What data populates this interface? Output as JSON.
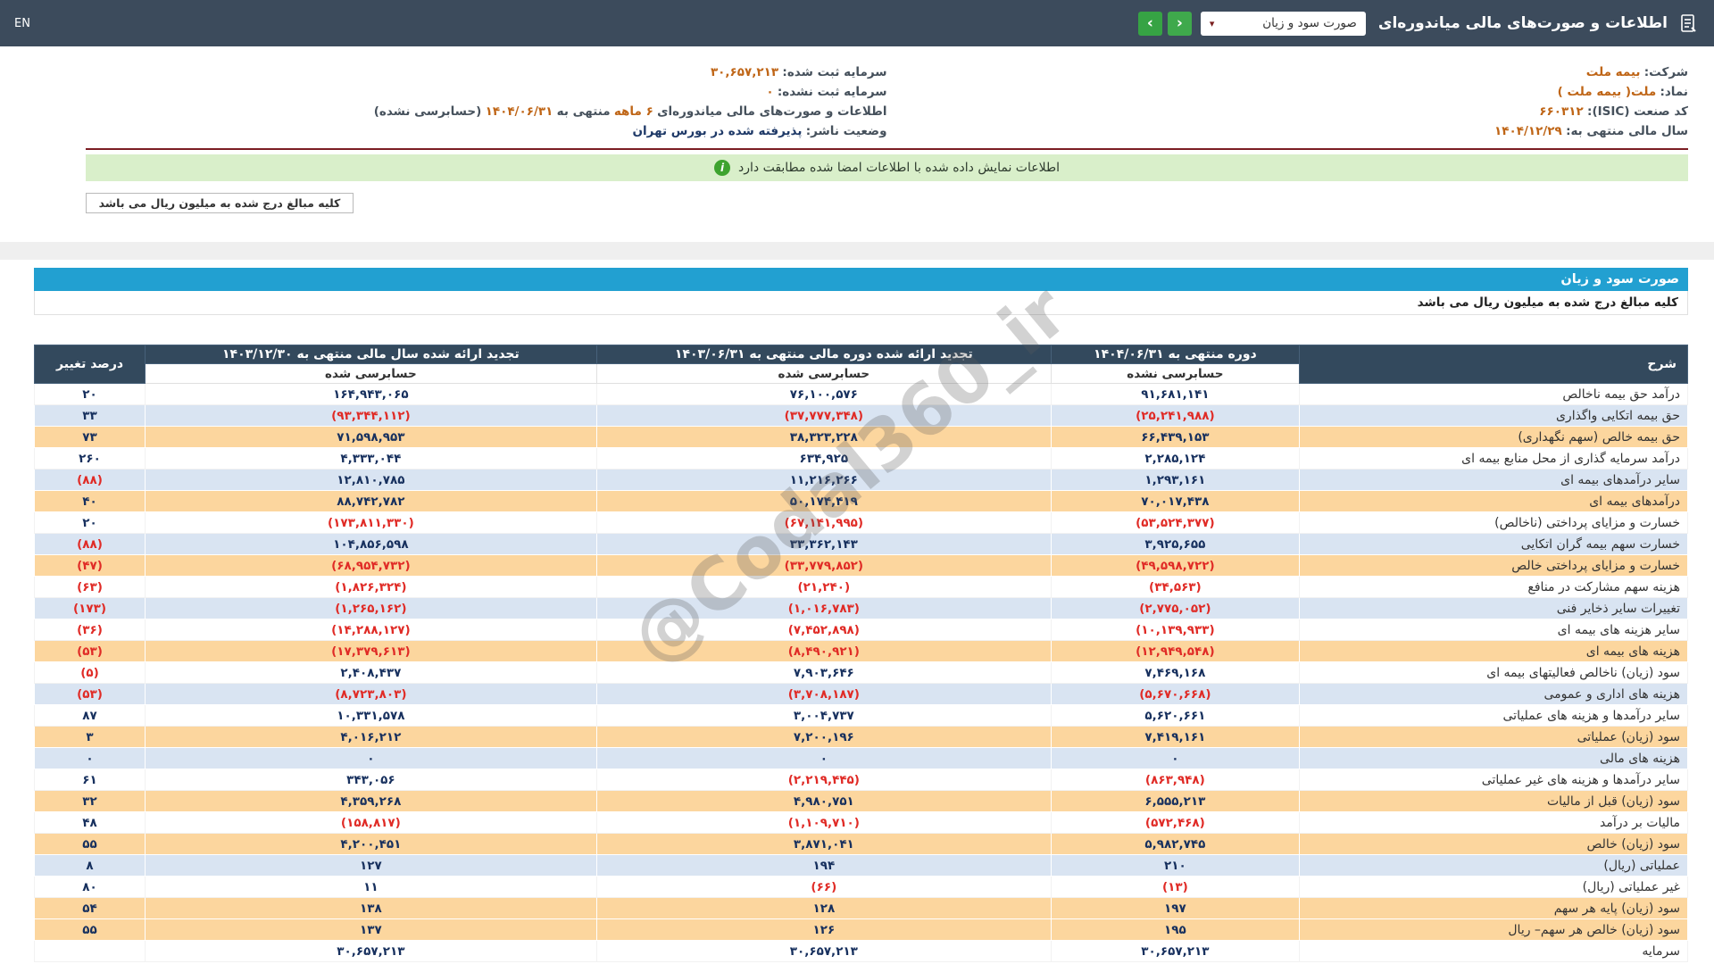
{
  "topbar": {
    "title": "اطلاعات و صورت‌های مالی میاندوره‌ای",
    "statement_select": "صورت سود و زیان",
    "nav_next": "‹",
    "nav_prev": "›",
    "lang": "EN"
  },
  "info": {
    "company_label": "شرکت:",
    "company_value": "بیمه ملت",
    "symbol_label": "نماد:",
    "symbol_value": "ملت( بیمه ملت )",
    "isic_label": "کد صنعت (ISIC):",
    "isic_value": "۶۶۰۳۱۲",
    "fiscal_year_label": "سال مالی منتهی به:",
    "fiscal_year_value": "۱۴۰۴/۱۲/۲۹",
    "registered_capital_label": "سرمایه ثبت شده:",
    "registered_capital_value": "۳۰,۶۵۷,۲۱۳",
    "unregistered_capital_label": "سرمایه ثبت نشده:",
    "unregistered_capital_value": "۰",
    "period_prefix": "اطلاعات و صورت‌های مالی میاندوره‌ای",
    "period_highlight": "۶ ماهه",
    "period_mid": "منتهی به",
    "period_date": "۱۴۰۴/۰۶/۳۱",
    "period_suffix": "(حسابرسی نشده)",
    "issuer_status_label": "وضعیت ناشر:",
    "issuer_status_value": "پذیرفته شده در بورس تهران"
  },
  "banner": {
    "text": "اطلاعات نمایش داده شده با اطلاعات امضا شده مطابقت دارد"
  },
  "units_note": "کلیه مبالغ درج شده به میلیون ریال می باشد",
  "section": {
    "title": "صورت سود و زیان",
    "units_note": "کلیه مبالغ درج شده به میلیون ریال می باشد"
  },
  "watermark": "@Codal360_ir",
  "colors": {
    "topbar-bg": "#3c4b5c",
    "section-bar-bg": "#22a0d1",
    "header-bg": "#33495d",
    "row-blue": "#d9e4f2",
    "row-orange": "#fcd69e",
    "num-pos": "#17305e",
    "num-neg": "#e02b26",
    "value-orange": "#bf6516",
    "banner-green-bg": "#d9efca",
    "banner-icon-green": "#3da32e",
    "nav-green": "#3fa94c",
    "maroon-line": "#7b1d23"
  },
  "table": {
    "headers": {
      "desc": "شرح",
      "col1": "دوره منتهی به ۱۴۰۴/۰۶/۳۱",
      "col1_sub": "حسابرسی نشده",
      "col2": "تجدید ارائه شده دوره مالی منتهی به ۱۴۰۳/۰۶/۳۱",
      "col2_sub": "حسابرسی شده",
      "col3": "تجدید ارائه شده سال مالی منتهی به ۱۴۰۳/۱۲/۳۰",
      "col3_sub": "حسابرسی شده",
      "change": "درصد تغییر"
    },
    "rows": [
      {
        "label": "درآمد حق بیمه ناخالص",
        "v1": "۹۱,۶۸۱,۱۴۱",
        "v2": "۷۶,۱۰۰,۵۷۶",
        "v3": "۱۶۴,۹۴۳,۰۶۵",
        "chg": "۲۰",
        "bg": "white"
      },
      {
        "label": "حق بیمه اتکایی واگذاری",
        "v1": "(۲۵,۲۴۱,۹۸۸)",
        "v2": "(۳۷,۷۷۷,۳۴۸)",
        "v3": "(۹۳,۳۴۴,۱۱۲)",
        "chg": "۳۳",
        "bg": "blue"
      },
      {
        "label": "حق بیمه خالص (سهم نگهداری)",
        "v1": "۶۶,۴۳۹,۱۵۳",
        "v2": "۳۸,۳۲۳,۲۲۸",
        "v3": "۷۱,۵۹۸,۹۵۳",
        "chg": "۷۳",
        "bg": "orange"
      },
      {
        "label": "درآمد سرمایه گذاری از محل منابع بیمه ای",
        "v1": "۲,۲۸۵,۱۲۴",
        "v2": "۶۳۴,۹۲۵",
        "v3": "۴,۳۳۳,۰۴۴",
        "chg": "۲۶۰",
        "bg": "white"
      },
      {
        "label": "سایر درآمدهای بیمه ای",
        "v1": "۱,۲۹۳,۱۶۱",
        "v2": "۱۱,۲۱۶,۲۶۶",
        "v3": "۱۲,۸۱۰,۷۸۵",
        "chg": "(۸۸)",
        "bg": "blue"
      },
      {
        "label": "درآمدهای بیمه ای",
        "v1": "۷۰,۰۱۷,۴۳۸",
        "v2": "۵۰,۱۷۴,۴۱۹",
        "v3": "۸۸,۷۴۲,۷۸۲",
        "chg": "۴۰",
        "bg": "orange"
      },
      {
        "label": "خسارت و مزایای پرداختی (ناخالص)",
        "v1": "(۵۳,۵۲۴,۳۷۷)",
        "v2": "(۶۷,۱۴۱,۹۹۵)",
        "v3": "(۱۷۳,۸۱۱,۳۳۰)",
        "chg": "۲۰",
        "bg": "white"
      },
      {
        "label": "خسارت سهم بیمه گران اتکایی",
        "v1": "۳,۹۲۵,۶۵۵",
        "v2": "۳۳,۳۶۲,۱۴۳",
        "v3": "۱۰۴,۸۵۶,۵۹۸",
        "chg": "(۸۸)",
        "bg": "blue"
      },
      {
        "label": "خسارت و مزایای پرداختی خالص",
        "v1": "(۴۹,۵۹۸,۷۲۲)",
        "v2": "(۳۳,۷۷۹,۸۵۲)",
        "v3": "(۶۸,۹۵۴,۷۳۲)",
        "chg": "(۴۷)",
        "bg": "orange"
      },
      {
        "label": "هزینه سهم مشارکت در منافع",
        "v1": "(۳۴,۵۶۳)",
        "v2": "(۲۱,۲۴۰)",
        "v3": "(۱,۸۲۶,۳۲۴)",
        "chg": "(۶۳)",
        "bg": "white"
      },
      {
        "label": "تغییرات سایر ذخایر فنی",
        "v1": "(۲,۷۷۵,۰۵۲)",
        "v2": "(۱,۰۱۶,۷۸۳)",
        "v3": "(۱,۲۶۵,۱۶۲)",
        "chg": "(۱۷۳)",
        "bg": "blue"
      },
      {
        "label": "سایر هزینه های بیمه ای",
        "v1": "(۱۰,۱۳۹,۹۳۳)",
        "v2": "(۷,۴۵۲,۸۹۸)",
        "v3": "(۱۴,۲۸۸,۱۲۷)",
        "chg": "(۳۶)",
        "bg": "white"
      },
      {
        "label": "هزینه های بیمه ای",
        "v1": "(۱۲,۹۴۹,۵۴۸)",
        "v2": "(۸,۴۹۰,۹۲۱)",
        "v3": "(۱۷,۳۷۹,۶۱۳)",
        "chg": "(۵۳)",
        "bg": "orange"
      },
      {
        "label": "سود (زیان) ناخالص فعالیتهای بیمه ای",
        "v1": "۷,۴۶۹,۱۶۸",
        "v2": "۷,۹۰۳,۶۴۶",
        "v3": "۲,۴۰۸,۴۳۷",
        "chg": "(۵)",
        "bg": "white"
      },
      {
        "label": "هزینه های اداری و عمومی",
        "v1": "(۵,۶۷۰,۶۶۸)",
        "v2": "(۳,۷۰۸,۱۸۷)",
        "v3": "(۸,۷۲۳,۸۰۳)",
        "chg": "(۵۳)",
        "bg": "blue"
      },
      {
        "label": "سایر درآمدها و هزینه های عملیاتی",
        "v1": "۵,۶۲۰,۶۶۱",
        "v2": "۳,۰۰۴,۷۳۷",
        "v3": "۱۰,۳۳۱,۵۷۸",
        "chg": "۸۷",
        "bg": "white"
      },
      {
        "label": "سود (زیان) عملیاتی",
        "v1": "۷,۴۱۹,۱۶۱",
        "v2": "۷,۲۰۰,۱۹۶",
        "v3": "۴,۰۱۶,۲۱۲",
        "chg": "۳",
        "bg": "orange"
      },
      {
        "label": "هزینه های مالی",
        "v1": "۰",
        "v2": "۰",
        "v3": "۰",
        "chg": "۰",
        "bg": "blue"
      },
      {
        "label": "سایر درآمدها و هزینه های غیر عملیاتی",
        "v1": "(۸۶۳,۹۴۸)",
        "v2": "(۲,۲۱۹,۴۴۵)",
        "v3": "۳۴۳,۰۵۶",
        "chg": "۶۱",
        "bg": "white"
      },
      {
        "label": "سود (زیان) قبل از مالیات",
        "v1": "۶,۵۵۵,۲۱۳",
        "v2": "۴,۹۸۰,۷۵۱",
        "v3": "۴,۳۵۹,۲۶۸",
        "chg": "۳۲",
        "bg": "orange"
      },
      {
        "label": "مالیات بر درآمد",
        "v1": "(۵۷۲,۴۶۸)",
        "v2": "(۱,۱۰۹,۷۱۰)",
        "v3": "(۱۵۸,۸۱۷)",
        "chg": "۴۸",
        "bg": "white"
      },
      {
        "label": "سود (زیان) خالص",
        "v1": "۵,۹۸۲,۷۴۵",
        "v2": "۳,۸۷۱,۰۴۱",
        "v3": "۴,۲۰۰,۴۵۱",
        "chg": "۵۵",
        "bg": "orange"
      },
      {
        "label": "عملیاتی (ریال)",
        "v1": "۲۱۰",
        "v2": "۱۹۴",
        "v3": "۱۲۷",
        "chg": "۸",
        "bg": "blue"
      },
      {
        "label": "غیر عملیاتی (ریال)",
        "v1": "(۱۳)",
        "v2": "(۶۶)",
        "v3": "۱۱",
        "chg": "۸۰",
        "bg": "white"
      },
      {
        "label": "سود (زیان) پایه هر سهم",
        "v1": "۱۹۷",
        "v2": "۱۲۸",
        "v3": "۱۳۸",
        "chg": "۵۴",
        "bg": "orange"
      },
      {
        "label": "سود (زیان) خالص هر سهم– ریال",
        "v1": "۱۹۵",
        "v2": "۱۲۶",
        "v3": "۱۳۷",
        "chg": "۵۵",
        "bg": "orange"
      },
      {
        "label": "سرمایه",
        "v1": "۳۰,۶۵۷,۲۱۳",
        "v2": "۳۰,۶۵۷,۲۱۳",
        "v3": "۳۰,۶۵۷,۲۱۳",
        "chg": "",
        "bg": "white"
      }
    ]
  }
}
